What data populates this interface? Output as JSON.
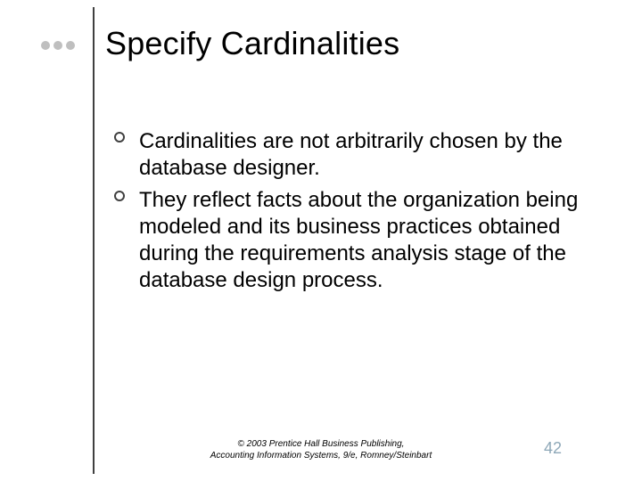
{
  "title": "Specify Cardinalities",
  "bullets": [
    "Cardinalities are not arbitrarily chosen by the database designer.",
    "They reflect facts about the organization being modeled and its business practices obtained during the requirements analysis stage of the database design process."
  ],
  "footer": {
    "line1": "© 2003 Prentice Hall Business Publishing,",
    "line2": "Accounting Information Systems, 9/e, Romney/Steinbart"
  },
  "page_number": "42"
}
